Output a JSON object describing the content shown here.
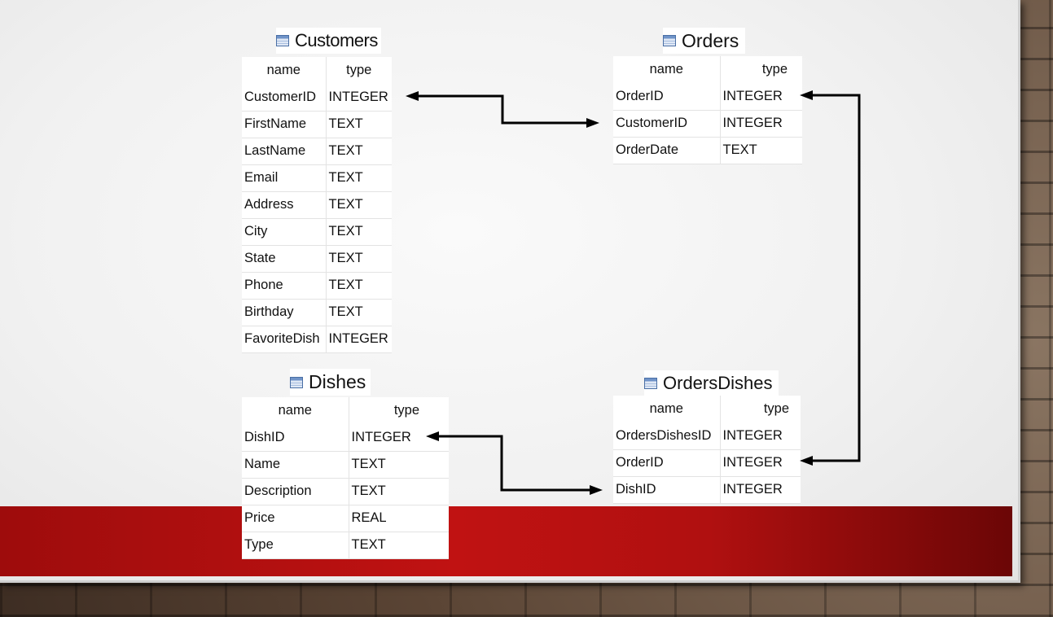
{
  "columns": {
    "name_header": "name",
    "type_header": "type"
  },
  "tables": {
    "customers": {
      "title": "Customers",
      "rows": [
        {
          "name": "CustomerID",
          "type": "INTEGER"
        },
        {
          "name": "FirstName",
          "type": "TEXT"
        },
        {
          "name": "LastName",
          "type": "TEXT"
        },
        {
          "name": "Email",
          "type": "TEXT"
        },
        {
          "name": "Address",
          "type": "TEXT"
        },
        {
          "name": "City",
          "type": "TEXT"
        },
        {
          "name": "State",
          "type": "TEXT"
        },
        {
          "name": "Phone",
          "type": "TEXT"
        },
        {
          "name": "Birthday",
          "type": "TEXT"
        },
        {
          "name": "FavoriteDish",
          "type": "INTEGER"
        }
      ]
    },
    "orders": {
      "title": "Orders",
      "rows": [
        {
          "name": "OrderID",
          "type": "INTEGER"
        },
        {
          "name": "CustomerID",
          "type": "INTEGER"
        },
        {
          "name": "OrderDate",
          "type": "TEXT"
        }
      ]
    },
    "dishes": {
      "title": "Dishes",
      "rows": [
        {
          "name": "DishID",
          "type": "INTEGER"
        },
        {
          "name": "Name",
          "type": "TEXT"
        },
        {
          "name": "Description",
          "type": "TEXT"
        },
        {
          "name": "Price",
          "type": "REAL"
        },
        {
          "name": "Type",
          "type": "TEXT"
        }
      ]
    },
    "orders_dishes": {
      "title": "OrdersDishes",
      "rows": [
        {
          "name": "OrdersDishesID",
          "type": "INTEGER"
        },
        {
          "name": "OrderID",
          "type": "INTEGER"
        },
        {
          "name": "DishID",
          "type": "INTEGER"
        }
      ]
    }
  },
  "relationships": [
    {
      "from": "customers.CustomerID",
      "to": "orders.CustomerID"
    },
    {
      "from": "orders.OrderID",
      "to": "orders_dishes.OrderID"
    },
    {
      "from": "dishes.DishID",
      "to": "orders_dishes.DishID"
    }
  ],
  "colors": {
    "band": "#c01212",
    "arrow": "#000000",
    "icon": "#4a6fa5"
  }
}
